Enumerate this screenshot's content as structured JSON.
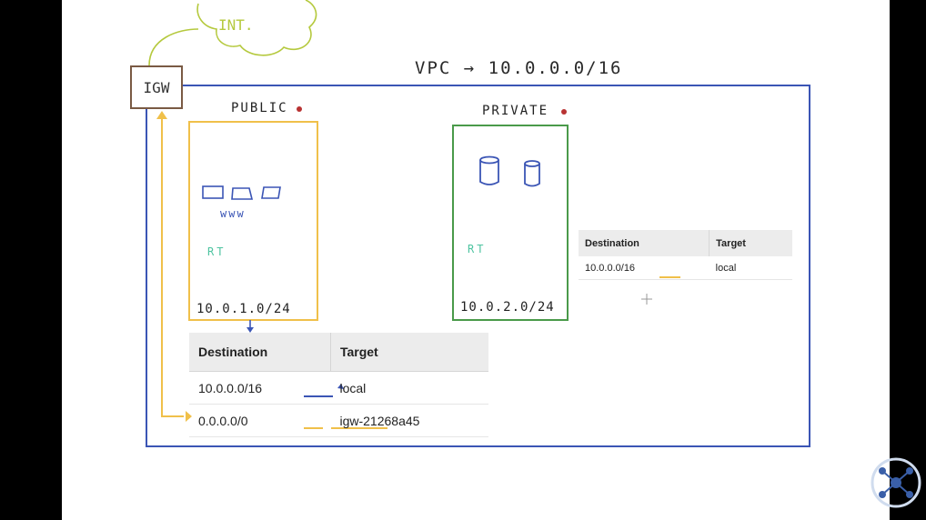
{
  "diagram": {
    "vpc_label": "VPC → 10.0.0.0/16",
    "internet_label": "INT.",
    "igw_label": "IGW",
    "public_subnet": {
      "title": "PUBLIC",
      "servers_label": "www",
      "route_table_label": "RT",
      "cidr": "10.0.1.0/24"
    },
    "private_subnet": {
      "title": "PRIVATE",
      "route_table_label": "RT",
      "cidr": "10.0.2.0/24"
    },
    "colors": {
      "vpc": "#3b55b5",
      "public": "#f0c04a",
      "private": "#4a9a4a",
      "internet": "#b5c93e",
      "igw": "#7a5a44",
      "route_arrow": "#f0c04a"
    }
  },
  "public_route_table": {
    "headers": [
      "Destination",
      "Target"
    ],
    "rows": [
      {
        "destination": "10.0.0.0/16",
        "target": "local"
      },
      {
        "destination": "0.0.0.0/0",
        "target": "igw-21268a45"
      }
    ]
  },
  "private_route_table": {
    "headers": [
      "Destination",
      "Target"
    ],
    "rows": [
      {
        "destination": "10.0.0.0/16",
        "target": "local"
      }
    ]
  }
}
